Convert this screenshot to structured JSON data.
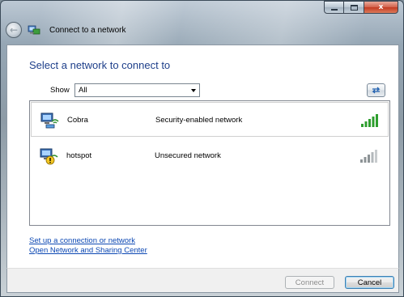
{
  "window": {
    "title": "Connect to a network",
    "controls": {
      "close_glyph": "x"
    }
  },
  "main": {
    "heading": "Select a network to connect to",
    "show_label": "Show",
    "filter_value": "All",
    "refresh_icon": "refresh-arrows-icon"
  },
  "networks": [
    {
      "name": "Cobra",
      "security": "Security-enabled network",
      "selected": true,
      "signal_bars": 5,
      "signal_color": "#2e9e2e",
      "secured": true
    },
    {
      "name": "hotspot",
      "security": "Unsecured network",
      "selected": false,
      "signal_bars": 5,
      "signal_color": "#9aa0a4",
      "secured": false
    }
  ],
  "links": {
    "setup": "Set up a connection or network",
    "sharing_center": "Open Network and Sharing Center"
  },
  "buttons": {
    "connect": "Connect",
    "cancel": "Cancel"
  },
  "colors": {
    "heading": "#1e3f8a",
    "link": "#0b47b3"
  }
}
